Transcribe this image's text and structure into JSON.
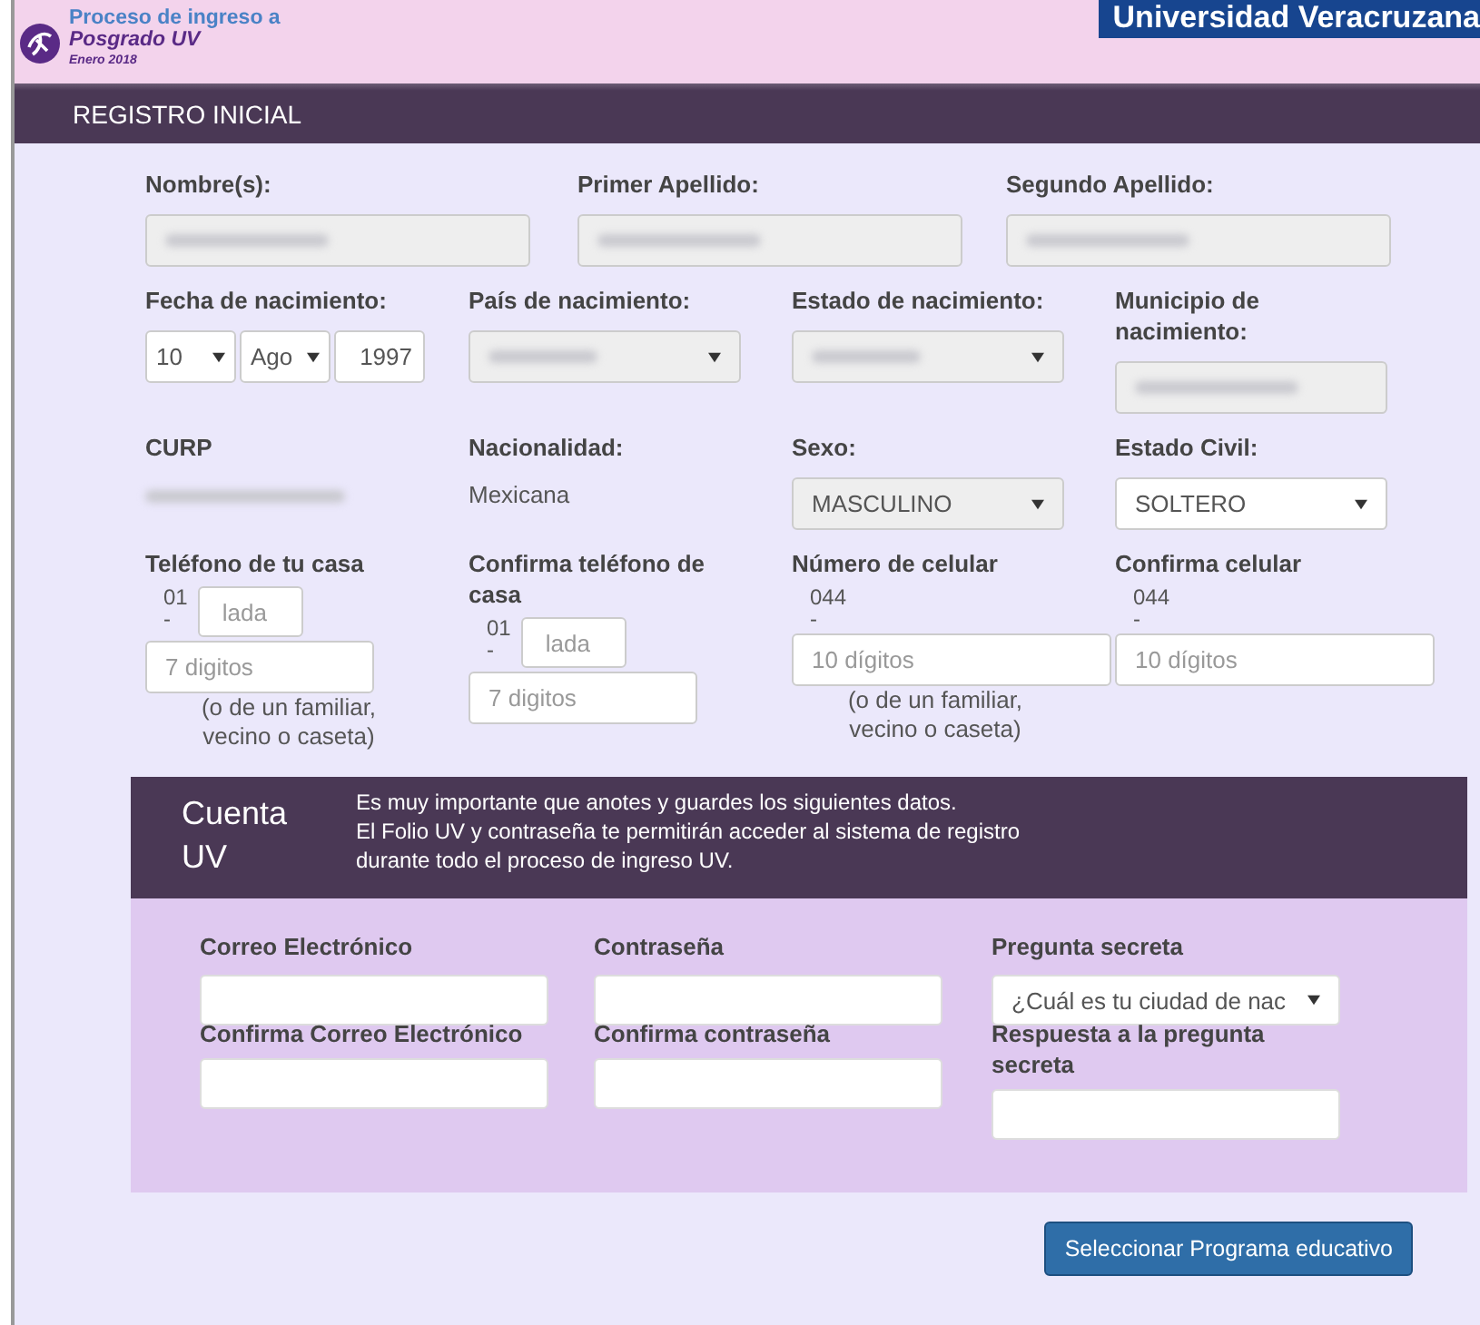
{
  "header": {
    "title": "Proceso de ingreso a",
    "subtitle": "Posgrado UV",
    "date": "Enero 2018",
    "brand": "Universidad Veracruzana"
  },
  "section_title": "REGISTRO INICIAL",
  "rows": [
    {
      "fields": [
        {
          "kind": "input",
          "label": "Nombre(s):",
          "disabled": true,
          "value_hidden": true
        },
        {
          "kind": "input",
          "label": "Primer Apellido:",
          "disabled": true,
          "value_hidden": true
        },
        {
          "kind": "input",
          "label": "Segundo Apellido:",
          "disabled": true,
          "value_hidden": true
        }
      ]
    },
    {
      "fields": [
        {
          "kind": "date",
          "label": "Fecha de nacimiento:",
          "day": "10",
          "month": "Ago",
          "year": "1997"
        },
        {
          "kind": "select",
          "label": "País de nacimiento:",
          "disabled": true,
          "value_hidden": true
        },
        {
          "kind": "select",
          "label": "Estado de nacimiento:",
          "disabled": true,
          "value_hidden": true
        },
        {
          "kind": "input",
          "label": "Municipio de nacimiento:",
          "disabled": true,
          "value_hidden": true
        }
      ]
    },
    {
      "fields": [
        {
          "kind": "text",
          "label": "CURP",
          "value_hidden": true
        },
        {
          "kind": "text",
          "label": "Nacionalidad:",
          "value": "Mexicana"
        },
        {
          "kind": "select",
          "label": "Sexo:",
          "disabled": true,
          "value": "MASCULINO"
        },
        {
          "kind": "select",
          "label": "Estado Civil:",
          "disabled": false,
          "value": "SOLTERO"
        }
      ]
    },
    {
      "fields": [
        {
          "kind": "phone",
          "label": "Teléfono de tu casa",
          "prefix": "01",
          "dash": "-",
          "lada_placeholder": "lada",
          "placeholder": "7 digitos",
          "note": "(o de un familiar, vecino o caseta)"
        },
        {
          "kind": "phone",
          "label": "Confirma teléfono de casa",
          "prefix": "01",
          "dash": "-",
          "lada_placeholder": "lada",
          "placeholder": "7 digitos"
        },
        {
          "kind": "cell",
          "label": "Número de celular",
          "prefix": "044",
          "dash": "-",
          "placeholder": "10 dígitos",
          "note": "(o de un familiar, vecino o caseta)"
        },
        {
          "kind": "cell",
          "label": "Confirma celular",
          "prefix": "044",
          "dash": "-",
          "placeholder": "10 dígitos"
        }
      ]
    }
  ],
  "account": {
    "title": "Cuenta UV",
    "notice": [
      "Es muy importante que anotes y guardes los siguientes datos.",
      "El Folio UV y contraseña te permitirán acceder al sistema de registro",
      "durante todo el proceso de ingreso UV."
    ],
    "columns": [
      [
        {
          "kind": "input",
          "label": "Correo Electrónico"
        },
        {
          "kind": "input",
          "label": "Confirma Correo Electrónico"
        }
      ],
      [
        {
          "kind": "input",
          "label": "Contraseña"
        },
        {
          "kind": "input",
          "label": "Confirma contraseña"
        }
      ],
      [
        {
          "kind": "select",
          "label": "Pregunta secreta",
          "value": "¿Cuál es tu ciudad de nac"
        },
        {
          "kind": "input",
          "label": "Respuesta a la pregunta secreta"
        }
      ]
    ]
  },
  "submit": "Seleccionar Programa educativo"
}
